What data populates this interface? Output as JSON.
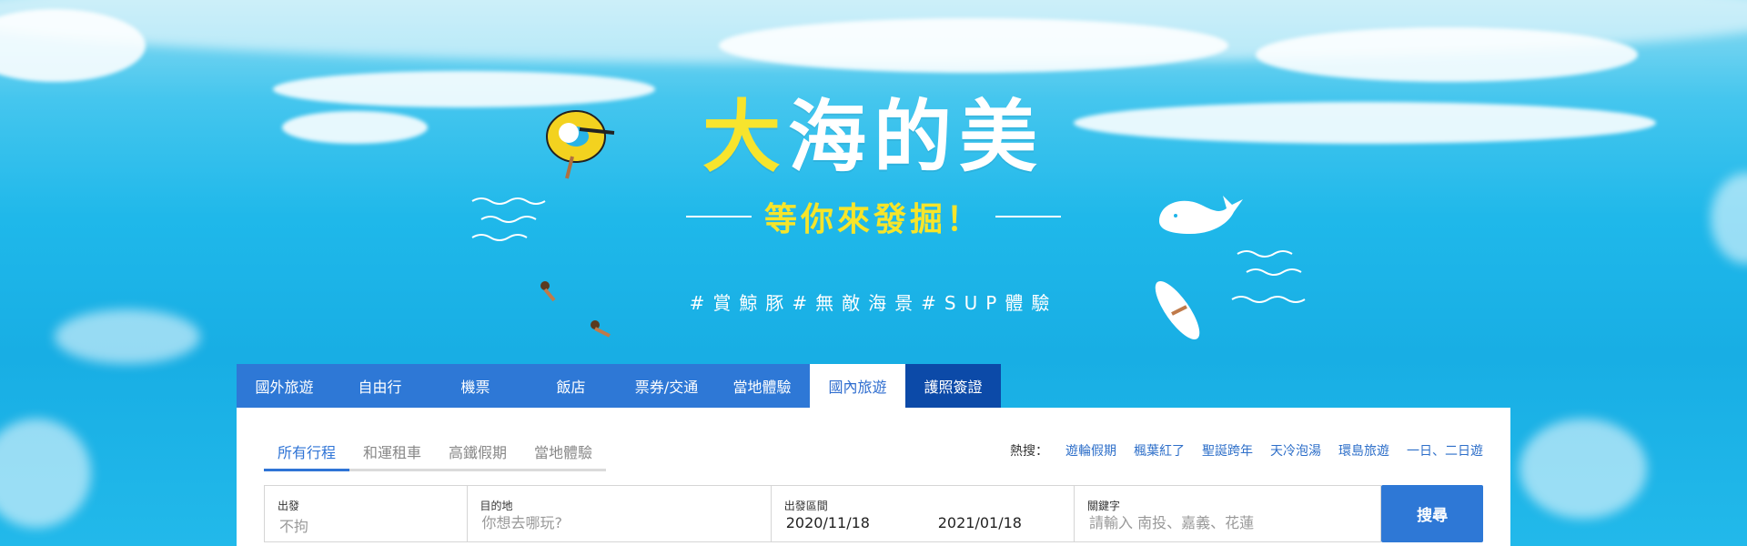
{
  "banner": {
    "headline_main_highlight": "大",
    "headline_main_rest": "海的美",
    "headline_sub": "等你來發掘！",
    "hashtags": "#賞鯨豚#無敵海景#SUP體驗"
  },
  "tabs": [
    {
      "label": "國外旅遊"
    },
    {
      "label": "自由行"
    },
    {
      "label": "機票"
    },
    {
      "label": "飯店"
    },
    {
      "label": "票券/交通"
    },
    {
      "label": "當地體驗"
    },
    {
      "label": "國內旅遊",
      "active": true
    },
    {
      "label": "護照簽證"
    }
  ],
  "subtabs": [
    {
      "label": "所有行程",
      "active": true
    },
    {
      "label": "和運租車"
    },
    {
      "label": "高鐵假期"
    },
    {
      "label": "當地體驗"
    }
  ],
  "hot_search": {
    "label": "熱搜：",
    "links": [
      "遊輪假期",
      "楓葉紅了",
      "聖誕跨年",
      "天冷泡湯",
      "環島旅遊",
      "一日、二日遊"
    ]
  },
  "search": {
    "depart_label": "出發",
    "depart_value": "不拘",
    "dest_label": "目的地",
    "dest_placeholder": "你想去哪玩?",
    "date_label": "出發區間",
    "date_from": "2020/11/18",
    "date_to": "2021/01/18",
    "keyword_label": "關鍵字",
    "keyword_placeholder": "請輸入 南投、嘉義、花蓮",
    "button_label": "搜尋"
  },
  "colors": {
    "tab_blue": "#2e78d6",
    "tab_dark": "#0c4aa8",
    "accent_yellow": "#f7e42d",
    "link_blue": "#2e6fc9"
  }
}
